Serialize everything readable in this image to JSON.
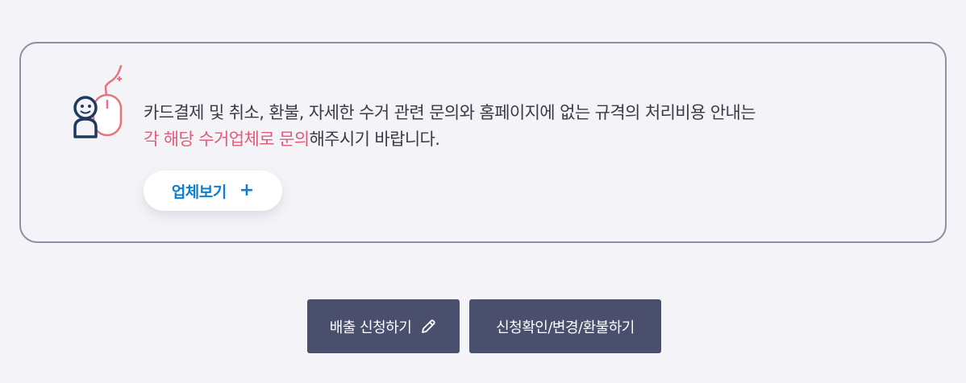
{
  "notice": {
    "line1": "카드결제 및 취소, 환불, 자세한 수거 관련 문의와 홈페이지에 없는 규격의 처리비용 안내는",
    "line2_highlight": "각 해당 수거업체로 문의",
    "line2_rest": "해주시기 바랍니다.",
    "icon": "person-mouse-icon"
  },
  "vendor_button": {
    "label": "업체보기",
    "icon_text": "+"
  },
  "actions": {
    "apply_label": "배출 신청하기",
    "apply_icon": "pencil-icon",
    "check_label": "신청확인/변경/환불하기"
  },
  "colors": {
    "background": "#f4f4f8",
    "border": "#8e8ea4",
    "highlight": "#e05b78",
    "link_blue": "#0b7fd1",
    "button_bg": "#4b4f6e",
    "icon_navy": "#1e3a5f"
  }
}
